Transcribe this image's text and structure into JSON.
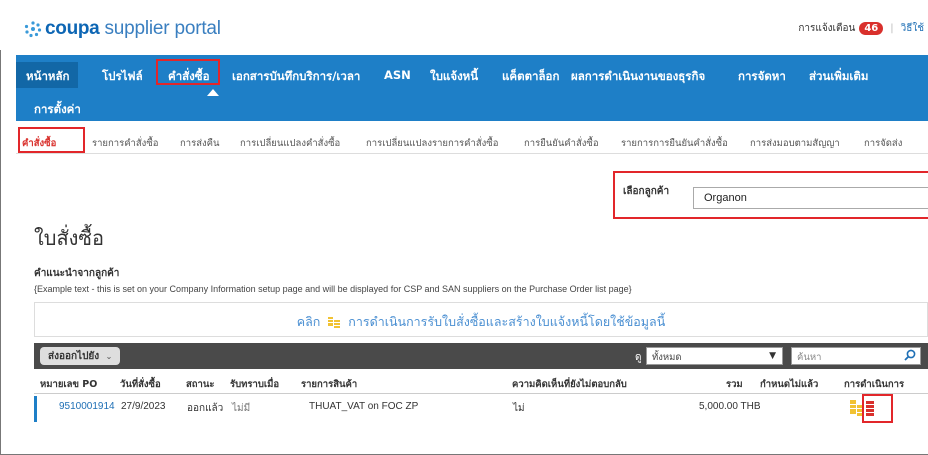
{
  "header": {
    "logo_brand": "coupa",
    "logo_sub": "supplier portal",
    "notifications_label": "การแจ้งเตือน",
    "notifications_count": "46",
    "help_label": "วิธีใช้"
  },
  "nav": {
    "items": [
      {
        "label": "หน้าหลัก"
      },
      {
        "label": "โปรไฟล์"
      },
      {
        "label": "คำสั่งซื้อ"
      },
      {
        "label": "เอกสารบันทึกบริการ/เวลา"
      },
      {
        "label": "ASN"
      },
      {
        "label": "ใบแจ้งหนี้"
      },
      {
        "label": "แค็ตตาล็อก"
      },
      {
        "label": "ผลการดำเนินงานของธุรกิจ"
      },
      {
        "label": "การจัดหา"
      },
      {
        "label": "ส่วนเพิ่มเติม"
      },
      {
        "label": "การตั้งค่า"
      }
    ]
  },
  "subnav": {
    "items": [
      {
        "label": "คำสั่งซื้อ"
      },
      {
        "label": "รายการคำสั่งซื้อ"
      },
      {
        "label": "การส่งคืน"
      },
      {
        "label": "การเปลี่ยนแปลงคำสั่งซื้อ"
      },
      {
        "label": "การเปลี่ยนแปลงรายการคำสั่งซื้อ"
      },
      {
        "label": "การยืนยันคำสั่งซื้อ"
      },
      {
        "label": "รายการการยืนยันคำสั่งซื้อ"
      },
      {
        "label": "การส่งมอบตามสัญญา"
      },
      {
        "label": "การจัดส่ง"
      }
    ]
  },
  "customer": {
    "label": "เลือกลูกค้า",
    "value": "Organon"
  },
  "page": {
    "title": "ใบสั่งซื้อ",
    "instructions_title": "คำแนะนำจากลูกค้า",
    "instructions_text": "{Example text - this is set on your Company Information setup page and will be displayed for CSP and SAN suppliers on the Purchase Order list page}",
    "flip_prefix": "คลิก",
    "flip_text": "การดำเนินการรับใบสั่งซื้อและสร้างใบแจ้งหนี้โดยใช้ข้อมูลนี้"
  },
  "toolbar": {
    "export_label": "ส่งออกไปยัง",
    "view_label": "ดู",
    "view_value": "ทั้งหมด",
    "search_placeholder": "ค้นหา"
  },
  "table": {
    "headers": [
      "หมายเลข PO",
      "วันที่สั่งซื้อ",
      "สถานะ",
      "รับทราบเมื่อ",
      "รายการสินค้า",
      "ความคิดเห็นที่ยังไม่ตอบกลับ",
      "รวม",
      "กำหนดไม่แล้ว",
      "การดำเนินการ"
    ],
    "rows": [
      {
        "po": "9510001914",
        "date": "27/9/2023",
        "status": "ออกแล้ว",
        "ack": "ไม่มี",
        "items": "THUAT_VAT on FOC ZP",
        "comments": "ไม่",
        "total": "5,000.00 THB",
        "assigned": ""
      }
    ]
  },
  "colors": {
    "nav_bg": "#1e7fc7",
    "nav_active_bg": "#1267a6",
    "highlight_red": "#e2262a",
    "brand_blue": "#0d66b4",
    "toolbar_bg": "#4a4a4a"
  }
}
